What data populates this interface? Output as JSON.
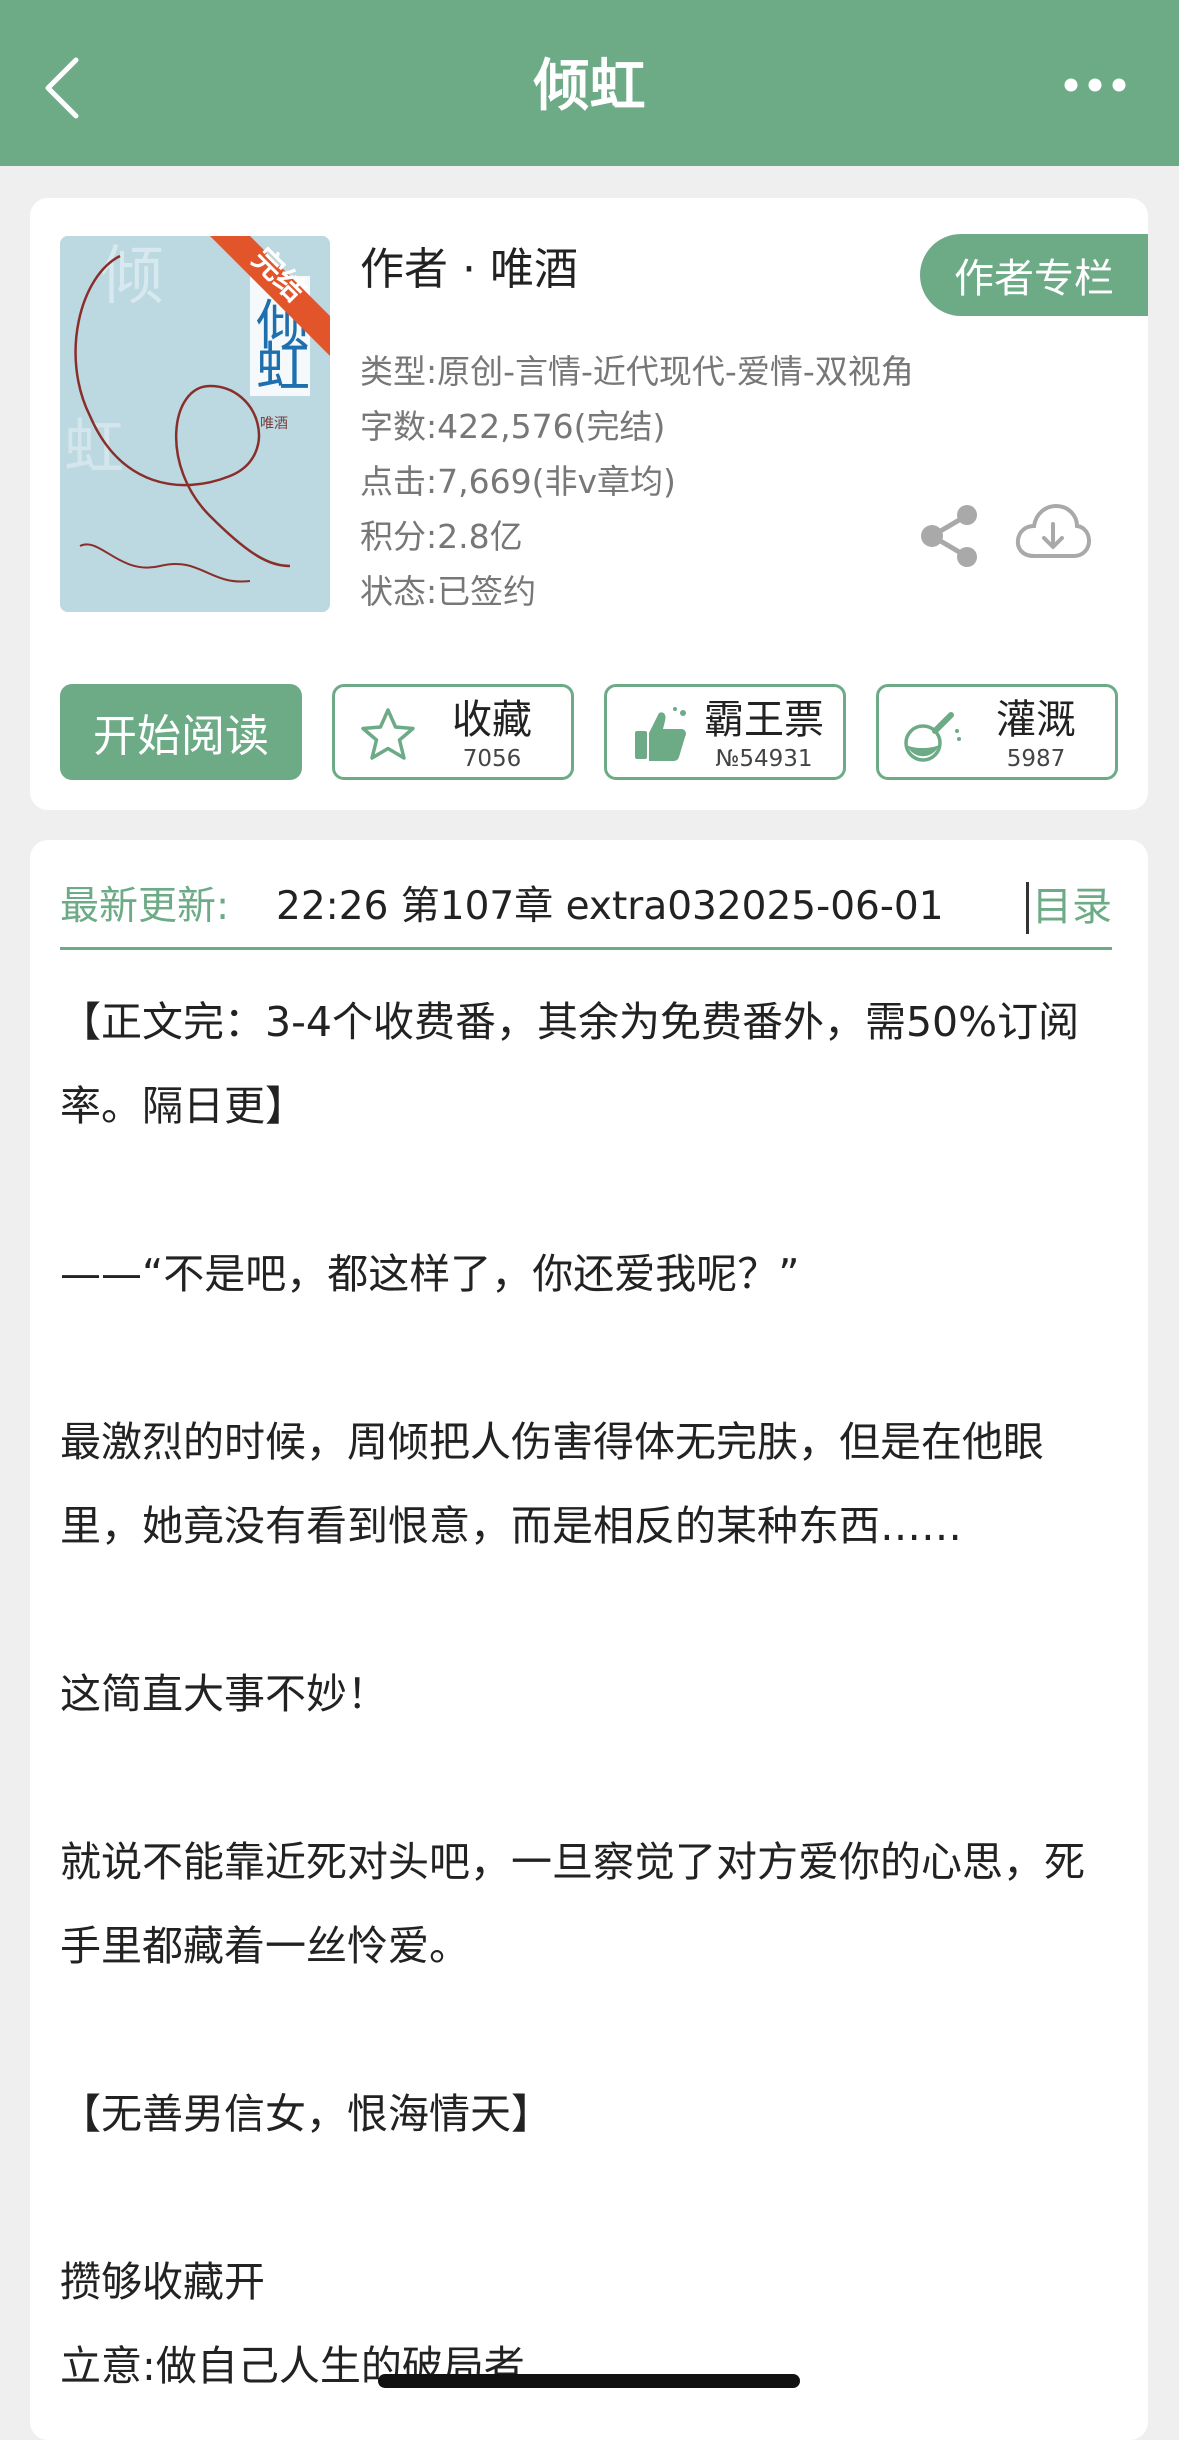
{
  "header": {
    "title": "倾虹",
    "back_icon": "chevron-left-icon",
    "more_icon": "more-horizontal-icon"
  },
  "book": {
    "cover": {
      "title_chars": [
        "倾",
        "虹"
      ],
      "author_mark": "唯酒",
      "status_ribbon": "完结"
    },
    "author_line": "作者 · 唯酒",
    "author_column_label": "作者专栏",
    "meta": [
      "类型:原创-言情-近代现代-爱情-双视角",
      "字数:422,576(完结)",
      "点击:7,669(非v章均)",
      "积分:2.8亿",
      "状态:已签约"
    ]
  },
  "actions": {
    "read_label": "开始阅读",
    "collect": {
      "label": "收藏",
      "count": "7056",
      "icon": "star-icon"
    },
    "vote": {
      "label": "霸王票",
      "count": "№54931",
      "icon": "thumbs-up-icon"
    },
    "water": {
      "label": "灌溉",
      "count": "5987",
      "icon": "flask-icon"
    }
  },
  "latest": {
    "label": "最新更新:",
    "text": "22:26   第107章 extra032025-06-01",
    "toc_label": "目录"
  },
  "description": [
    "【正文完：3-4个收费番，其余为免费番外，需50%订阅率。隔日更】",
    "——“不是吧，都这样了，你还爱我呢？”",
    "最激烈的时候，周倾把人伤害得体无完肤，但是在他眼里，她竟没有看到恨意，而是相反的某种东西……",
    "这简直大事不妙！",
    "就说不能靠近死对头吧，一旦察觉了对方爱你的心思，死手里都藏着一丝怜爱。",
    "【无善男信女，恨海情天】",
    "攒够收藏开",
    "立意:做自己人生的破局者"
  ],
  "colors": {
    "brand_green": "#6dab87",
    "background": "#efefef"
  }
}
